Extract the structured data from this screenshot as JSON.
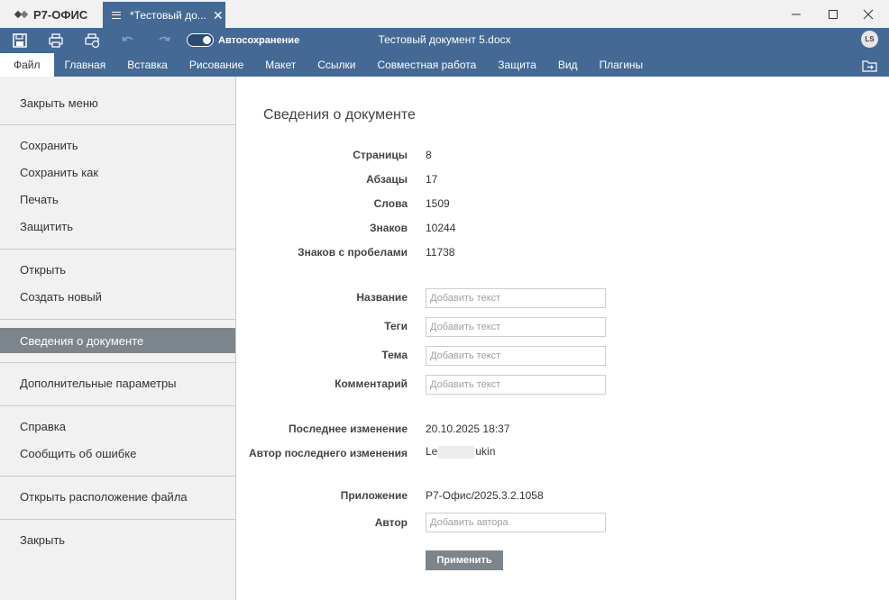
{
  "app": {
    "brand": "Р7-ОФИС",
    "tab_title": "*Тестовый до...",
    "doc_title": "Тестовый документ 5.docx",
    "autosave_label": "Автосохранение",
    "avatar_initials": "LS"
  },
  "ribbon_tabs": [
    "Файл",
    "Главная",
    "Вставка",
    "Рисование",
    "Макет",
    "Ссылки",
    "Совместная работа",
    "Защита",
    "Вид",
    "Плагины"
  ],
  "menu": {
    "close_menu": "Закрыть меню",
    "save": "Сохранить",
    "save_as": "Сохранить как",
    "print": "Печать",
    "protect": "Защитить",
    "open": "Открыть",
    "create_new": "Создать новый",
    "doc_info": "Сведения о документе",
    "advanced": "Дополнительные параметры",
    "help": "Справка",
    "report_bug": "Сообщить об ошибке",
    "open_location": "Открыть расположение файла",
    "close": "Закрыть"
  },
  "info": {
    "heading": "Сведения о документе",
    "stats": [
      {
        "label": "Страницы",
        "value": "8"
      },
      {
        "label": "Абзацы",
        "value": "17"
      },
      {
        "label": "Слова",
        "value": "1509"
      },
      {
        "label": "Знаков",
        "value": "10244"
      },
      {
        "label": "Знаков с пробелами",
        "value": "11738"
      }
    ],
    "fields": [
      {
        "label": "Название",
        "placeholder": "Добавить текст"
      },
      {
        "label": "Теги",
        "placeholder": "Добавить текст"
      },
      {
        "label": "Тема",
        "placeholder": "Добавить текст"
      },
      {
        "label": "Комментарий",
        "placeholder": "Добавить текст"
      }
    ],
    "last_modified_label": "Последнее изменение",
    "last_modified_value": "20.10.2025 18:37",
    "last_author_label": "Автор последнего изменения",
    "last_author_prefix": "Le",
    "last_author_suffix": "ukin",
    "app_label": "Приложение",
    "app_value": "Р7-Офис/2025.3.2.1058",
    "author_label": "Автор",
    "author_placeholder": "Добавить автора",
    "apply_button": "Применить"
  },
  "colors": {
    "accent": "#446995",
    "menu_active": "#7d858c",
    "sidebar_bg": "#f1f1f1"
  }
}
